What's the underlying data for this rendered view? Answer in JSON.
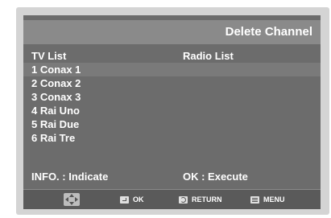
{
  "title": "Delete Channel",
  "columns": {
    "tv": "TV List",
    "radio": "Radio List"
  },
  "tv_channels": [
    "1 Conax 1",
    "2 Conax 2",
    "3 Conax 3",
    "4 Rai Uno",
    "5 Rai Due",
    "6 Rai Tre"
  ],
  "info": {
    "left": "INFO. : Indicate",
    "right": "OK : Execute"
  },
  "guide": {
    "ok": "OK",
    "return": "RETURN",
    "menu": "MENU"
  },
  "icons": [
    "nav-arrows-icon",
    "ok-icon",
    "return-icon",
    "menu-icon"
  ],
  "colors": {
    "panel": "#6c6c6c",
    "titlebar": "#8a8a8a",
    "selected_row": "#7a7a7a",
    "guide_bar": "#5a5a5a"
  }
}
